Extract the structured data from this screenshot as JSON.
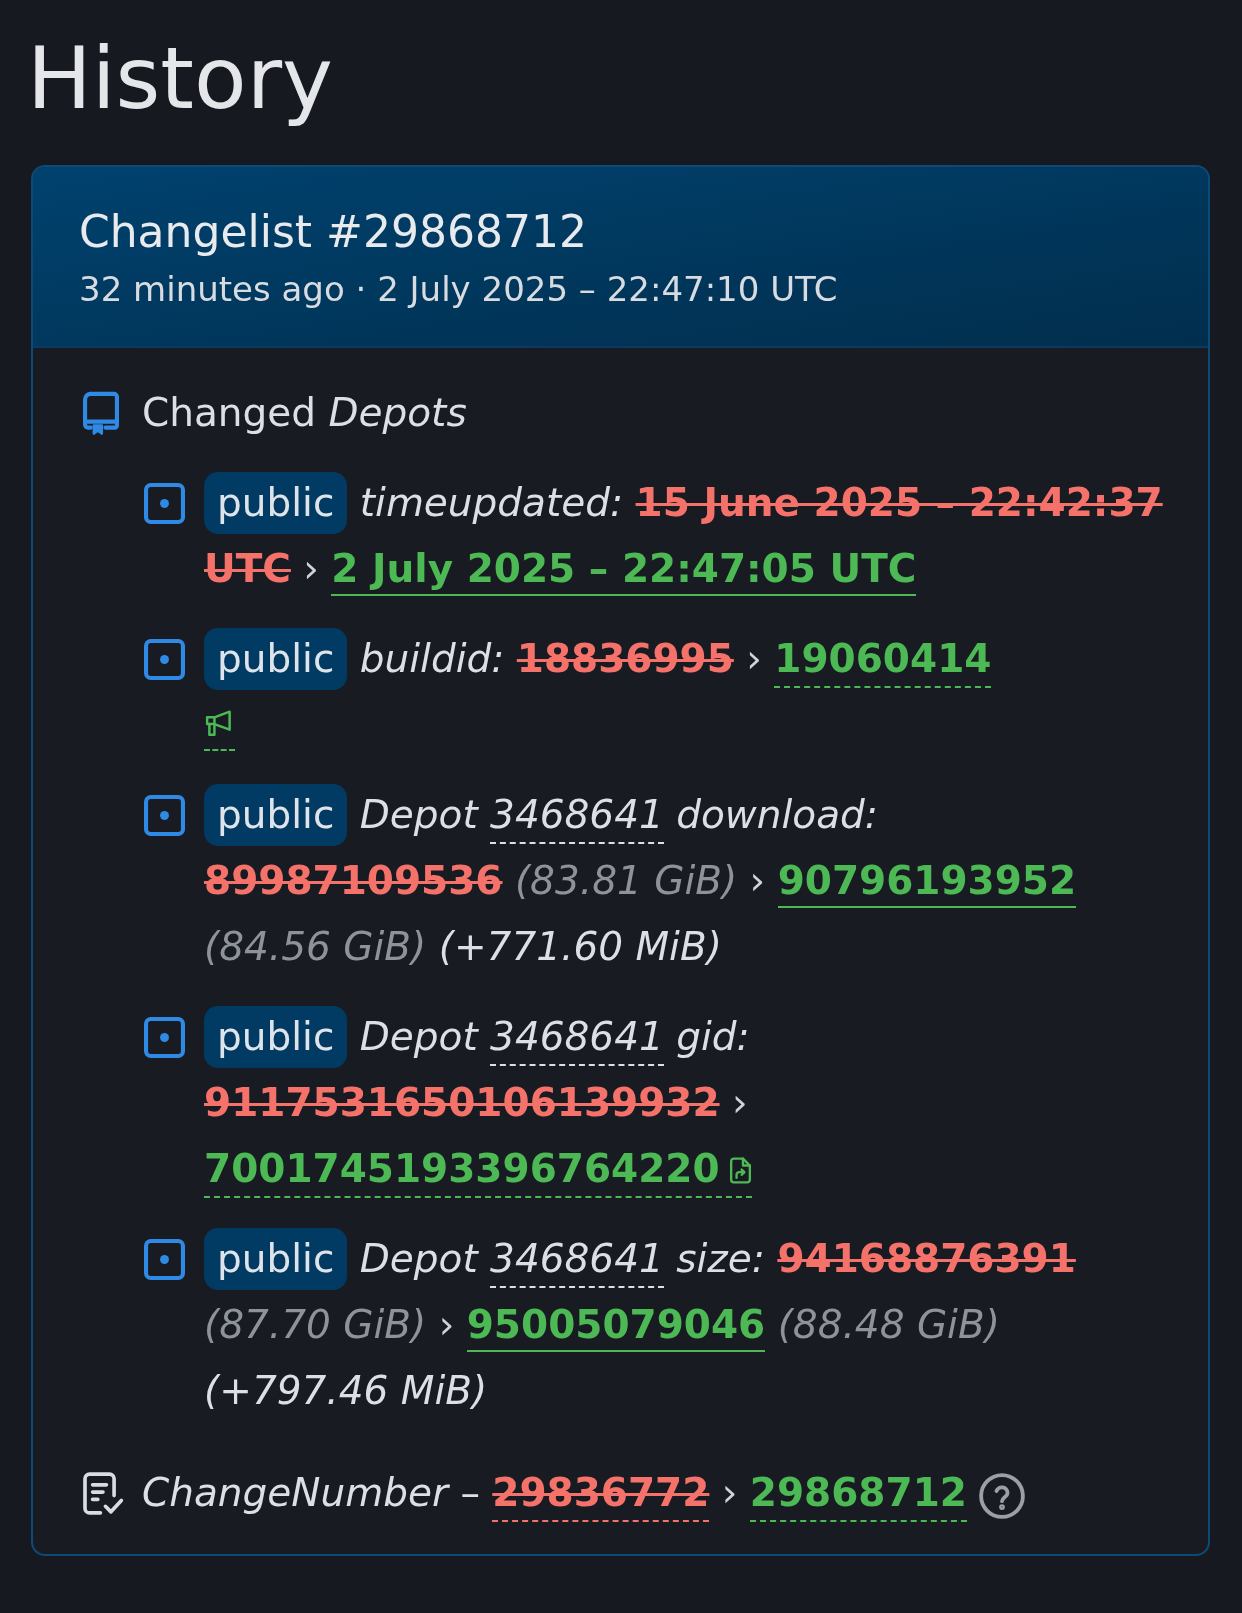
{
  "page": {
    "title": "History"
  },
  "changelist": {
    "title": "Changelist #29868712",
    "subtitle": "32 minutes ago · 2 July 2025 – 22:47:10 UTC",
    "section_title": "Changed *Depots*",
    "changes": [
      {
        "branch": "public",
        "segments": [
          {
            "kind": "label",
            "text": "timeupdated:"
          },
          {
            "kind": "old",
            "text": "15 June 2025 – 22:42:37"
          },
          {
            "kind": "old",
            "text": "UTC"
          },
          {
            "kind": "arrow",
            "text": "›"
          },
          {
            "kind": "new_link",
            "text": "2 July 2025 – 22:47:05 UTC"
          }
        ]
      },
      {
        "branch": "public",
        "segments": [
          {
            "kind": "label",
            "text": "buildid:"
          },
          {
            "kind": "old",
            "text": "18836995"
          },
          {
            "kind": "arrow",
            "text": "›"
          },
          {
            "kind": "new_hint",
            "text": "19060414"
          },
          {
            "kind": "news_link"
          }
        ]
      },
      {
        "branch": "public",
        "segments": [
          {
            "kind": "label",
            "text": "Depot"
          },
          {
            "kind": "ref",
            "text": "3468641"
          },
          {
            "kind": "label",
            "text": "download:"
          },
          {
            "kind": "old",
            "text": "89987109536"
          },
          {
            "kind": "size",
            "text": "(83.81 GiB)"
          },
          {
            "kind": "arrow",
            "text": "›"
          },
          {
            "kind": "new_link",
            "text": "90796193952"
          },
          {
            "kind": "size",
            "text": "(84.56 GiB)"
          },
          {
            "kind": "delta",
            "text": "(+771.60 MiB)"
          }
        ]
      },
      {
        "branch": "public",
        "segments": [
          {
            "kind": "label",
            "text": "Depot"
          },
          {
            "kind": "ref",
            "text": "3468641"
          },
          {
            "kind": "label",
            "text": "gid:"
          },
          {
            "kind": "old",
            "text": "9117531650106139932"
          },
          {
            "kind": "arrow",
            "text": "›"
          },
          {
            "kind": "new_hint",
            "text": "7001745193396764220",
            "manifest_link": true
          }
        ]
      },
      {
        "branch": "public",
        "segments": [
          {
            "kind": "label",
            "text": "Depot"
          },
          {
            "kind": "ref",
            "text": "3468641"
          },
          {
            "kind": "label",
            "text": "size:"
          },
          {
            "kind": "old",
            "text": "94168876391"
          },
          {
            "kind": "size",
            "text": "(87.70 GiB)"
          },
          {
            "kind": "arrow",
            "text": "›"
          },
          {
            "kind": "new_link",
            "text": "95005079046"
          },
          {
            "kind": "size",
            "text": "(88.48 GiB)"
          },
          {
            "kind": "delta",
            "text": "(+797.46 MiB)"
          }
        ]
      }
    ],
    "change_number": {
      "segments": [
        {
          "kind": "label",
          "text": "ChangeNumber"
        },
        {
          "kind": "plain",
          "text": "–"
        },
        {
          "kind": "old_hint",
          "text": "29836772"
        },
        {
          "kind": "arrow",
          "text": "›"
        },
        {
          "kind": "new_hint",
          "text": "29868712"
        },
        {
          "kind": "help"
        }
      ]
    }
  }
}
